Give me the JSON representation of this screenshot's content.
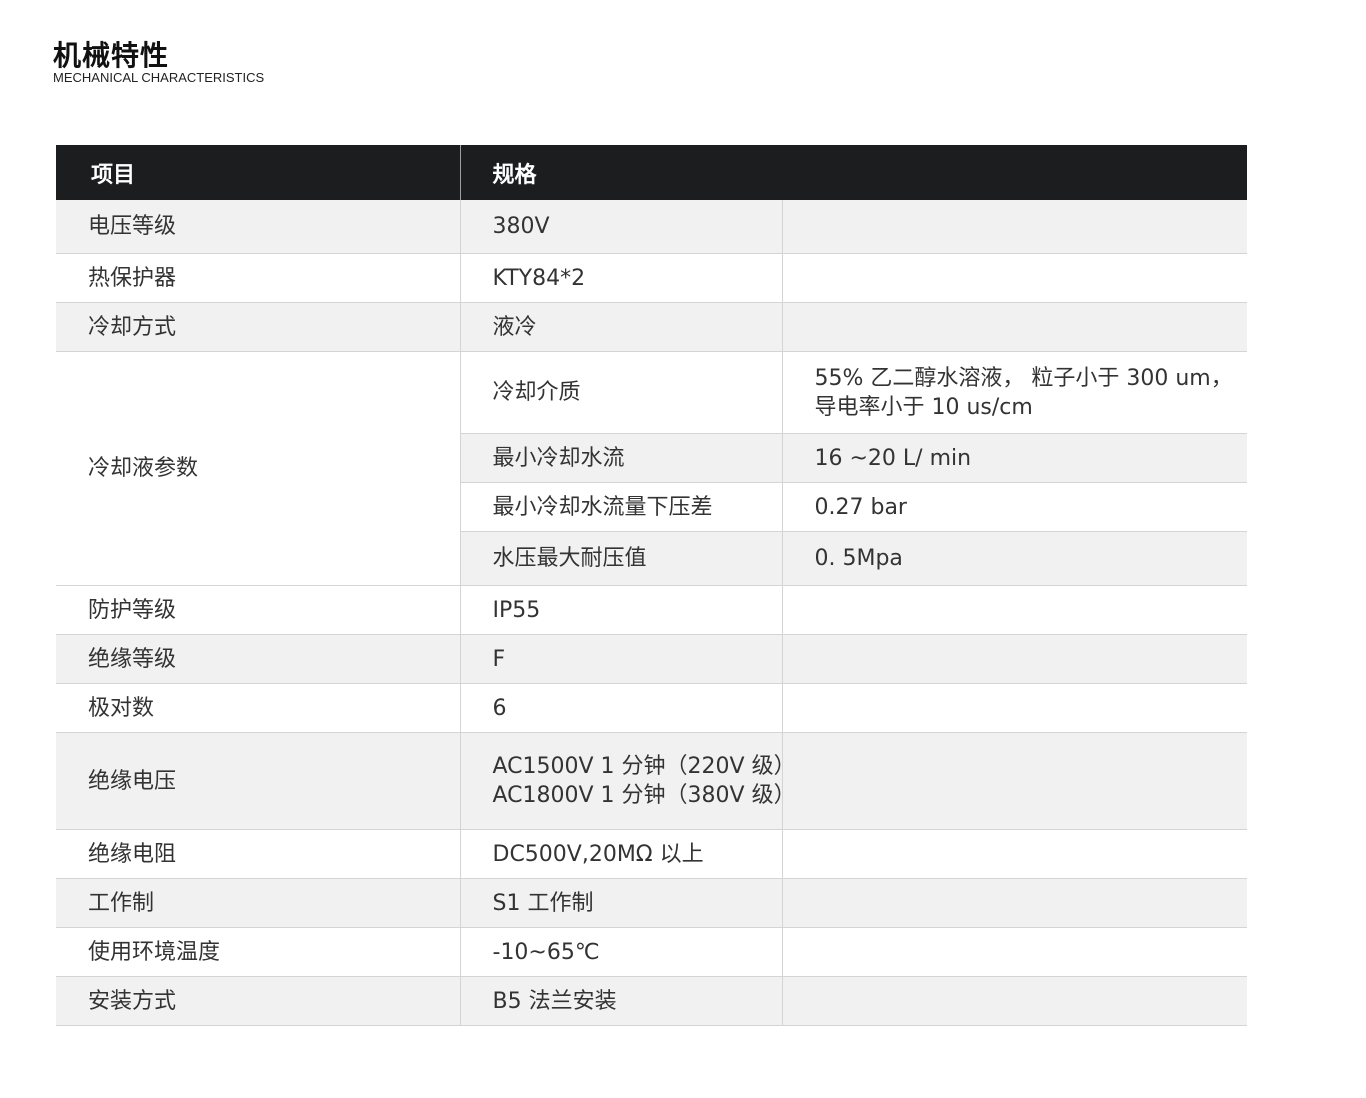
{
  "section": {
    "title_zh": "机械特性",
    "title_en": "MECHANICAL CHARACTERISTICS"
  },
  "table": {
    "headers": [
      "项目",
      "规格"
    ],
    "rows": {
      "voltage_class": {
        "item": "电压等级",
        "spec": "380V"
      },
      "thermal_protector": {
        "item": "热保护器",
        "spec": "KTY84*2"
      },
      "cooling_method": {
        "item": "冷却方式",
        "spec": "液冷"
      },
      "coolant": {
        "item": "冷却液参数",
        "medium": {
          "name": "冷却介质",
          "line1": "55% 乙二醇水溶液， 粒子小于 300 um，",
          "line2": "导电率小于 10 us/cm"
        },
        "min_flow": {
          "name": "最小冷却水流",
          "value": "16 ~20 L/ min"
        },
        "pressure_drop": {
          "name": "最小冷却水流量下压差",
          "value": "0.27 bar"
        },
        "max_pressure": {
          "name": "水压最大耐压值",
          "value": "0. 5Mpa"
        }
      },
      "protection_class": {
        "item": "防护等级",
        "spec": "IP55"
      },
      "insulation_class": {
        "item": "绝缘等级",
        "spec": "F"
      },
      "pole_pairs": {
        "item": "极对数",
        "spec": "6"
      },
      "insulation_voltage": {
        "item": "绝缘电压",
        "line1": "AC1500V 1 分钟（220V 级）",
        "line2": "AC1800V 1 分钟（380V 级）"
      },
      "insulation_resistance": {
        "item": "绝缘电阻",
        "spec": "DC500V,20MΩ 以上"
      },
      "duty": {
        "item": "工作制",
        "spec": "S1 工作制"
      },
      "ambient_temp": {
        "item": "使用环境温度",
        "spec": "-10~65℃"
      },
      "mounting": {
        "item": "安装方式",
        "spec": "B5 法兰安装"
      }
    }
  }
}
